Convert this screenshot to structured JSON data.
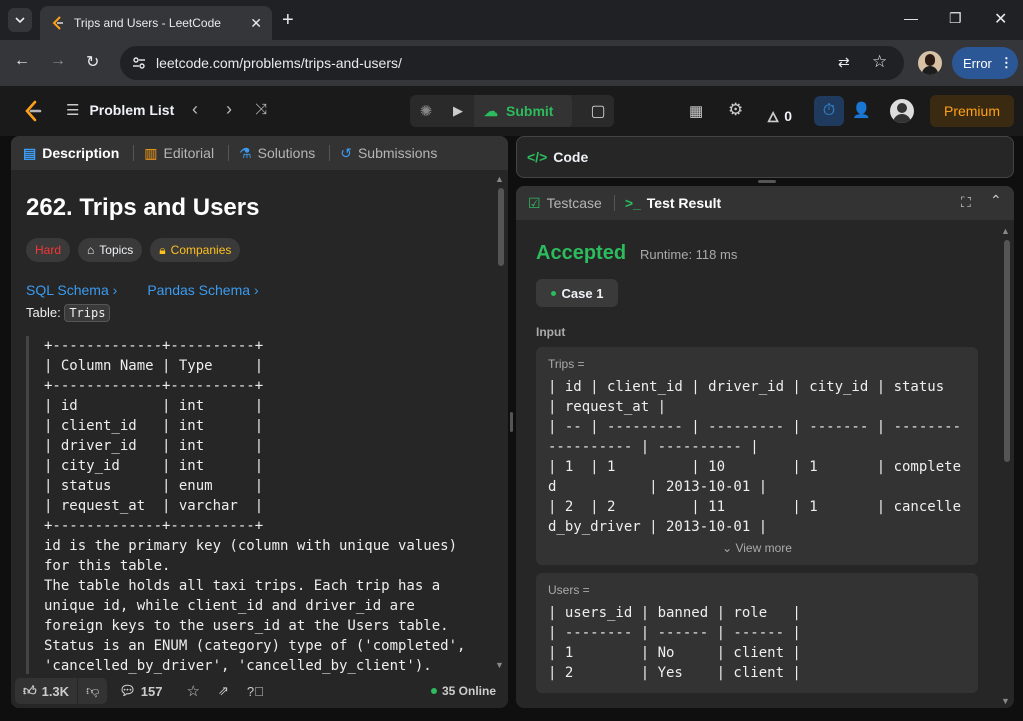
{
  "browser": {
    "tab_title": "Trips and Users - LeetCode",
    "url": "leetcode.com/problems/trips-and-users/",
    "error_label": "Error"
  },
  "nav": {
    "problem_list": "Problem List",
    "submit": "Submit",
    "streak": "0",
    "premium": "Premium"
  },
  "left": {
    "tabs": [
      "Description",
      "Editorial",
      "Solutions",
      "Submissions"
    ],
    "title": "262. Trips and Users",
    "badges": {
      "difficulty": "Hard",
      "topics": "Topics",
      "companies": "Companies"
    },
    "links": [
      "SQL Schema",
      "Pandas Schema"
    ],
    "table_label": "Table:",
    "table_name": "Trips",
    "schema_text": "+-------------+----------+\n| Column Name | Type     |\n+-------------+----------+\n| id          | int      |\n| client_id   | int      |\n| driver_id   | int      |\n| city_id     | int      |\n| status      | enum     |\n| request_at  | varchar  |\n+-------------+----------+\nid is the primary key (column with unique values)\nfor this table.\nThe table holds all taxi trips. Each trip has a\nunique id, while client_id and driver_id are\nforeign keys to the users_id at the Users table.\nStatus is an ENUM (category) type of ('completed',\n'cancelled_by_driver', 'cancelled_by_client').",
    "footer": {
      "likes": "1.3K",
      "comments": "157",
      "online": "35 Online"
    }
  },
  "code_panel": {
    "label": "Code"
  },
  "right": {
    "tabs": [
      "Testcase",
      "Test Result"
    ],
    "status": "Accepted",
    "runtime": "Runtime: 118 ms",
    "case": "Case 1",
    "input_label": "Input",
    "trips_label": "Trips =",
    "trips_text": "| id | client_id | driver_id | city_id | status\n| request_at |\n| -- | --------- | --------- | ------- | --------\n---------- | ---------- |\n| 1  | 1         | 10        | 1       | complete\nd           | 2013-10-01 |\n| 2  | 2         | 11        | 1       | cancelle\nd_by_driver | 2013-10-01 |",
    "view_more": "View more",
    "users_label": "Users =",
    "users_text": "| users_id | banned | role   |\n| -------- | ------ | ------ |\n| 1        | No     | client |\n| 2        | Yes    | client |"
  },
  "colors": {
    "accepted": "#2cbb5d",
    "hard": "#f63636",
    "premium": "#ffa116",
    "link": "#3b9bf0",
    "companies": "#ffc01e"
  }
}
